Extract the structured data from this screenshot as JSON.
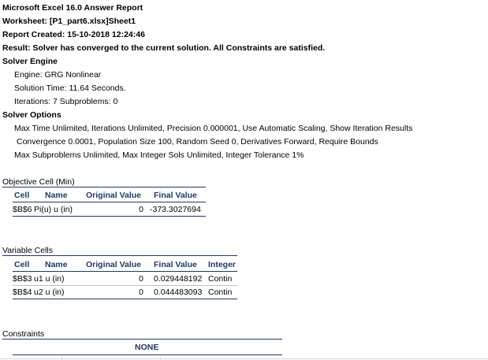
{
  "report": {
    "title": "Microsoft Excel 16.0 Answer Report",
    "worksheet": "Worksheet: [P1_part6.xlsx]Sheet1",
    "created": "Report Created: 15-10-2018 12:24:46",
    "result": "Result: Solver has converged to the current solution.  All Constraints are satisfied."
  },
  "engine": {
    "heading": "Solver Engine",
    "engine": "Engine: GRG Nonlinear",
    "time": "Solution Time: 11.64 Seconds.",
    "iterations": "Iterations: 7 Subproblems: 0"
  },
  "options": {
    "heading": "Solver Options",
    "line1": "Max Time Unlimited,  Iterations Unlimited, Precision 0.000001, Use Automatic Scaling, Show Iteration Results",
    "line2": "Convergence 0.0001, Population Size 100, Random Seed 0, Derivatives Forward, Require Bounds",
    "line3": "Max Subproblems Unlimited, Max Integer Sols Unlimited, Integer Tolerance 1%"
  },
  "objective": {
    "heading": "Objective Cell (Min)",
    "columns": [
      "Cell",
      "Name",
      "Original Value",
      "Final Value"
    ],
    "row": {
      "cell": "$B$6",
      "name": "Pi(u) u (in)",
      "original": "0",
      "final": "-373.3027694"
    }
  },
  "variables": {
    "heading": "Variable Cells",
    "columns": [
      "Cell",
      "Name",
      "Original Value",
      "Final Value",
      "Integer"
    ],
    "rows": [
      {
        "cell": "$B$3",
        "name": "u1 u (in)",
        "original": "0",
        "final": "0.029448192",
        "integer": "Contin"
      },
      {
        "cell": "$B$4",
        "name": "u2 u (in)",
        "original": "0",
        "final": "0.044483093",
        "integer": "Contin"
      }
    ]
  },
  "constraints": {
    "heading": "Constraints",
    "none": "NONE"
  },
  "colors": {
    "header_text": "#1f3864",
    "rule": "#1f3864"
  }
}
